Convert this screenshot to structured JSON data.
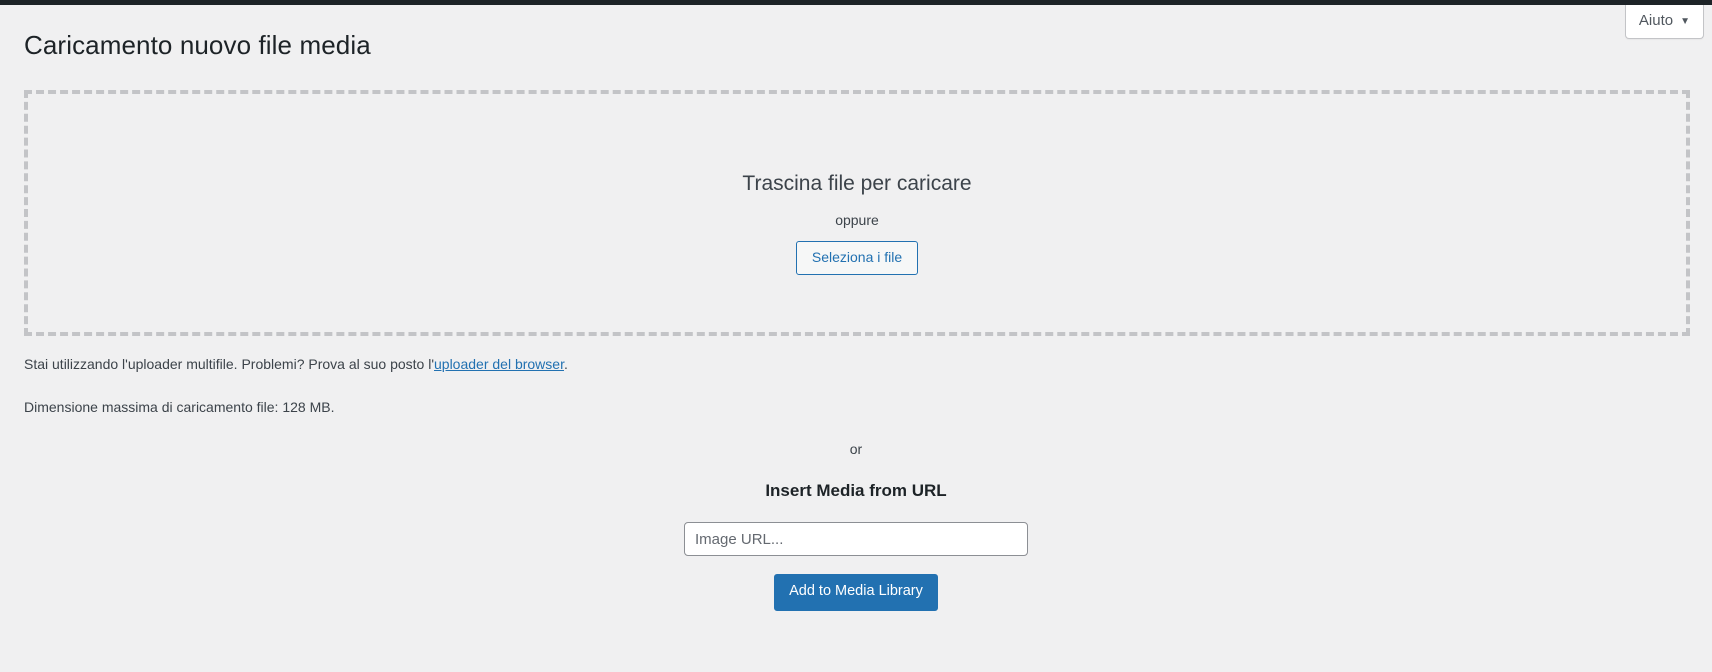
{
  "header": {
    "page_title": "Caricamento nuovo file media",
    "help_button_label": "Aiuto",
    "help_caret_icon": "chevron-down-icon"
  },
  "dropzone": {
    "instructions": "Trascina file per caricare",
    "or_label": "oppure",
    "select_files_label": "Seleziona i file"
  },
  "notes": {
    "multifile_prefix": "Stai utilizzando l'uploader multifile. Problemi? Prova al suo posto l'",
    "multifile_link": "uploader del browser",
    "multifile_suffix": ".",
    "max_upload_size": "Dimensione massima di caricamento file: 128 MB."
  },
  "url_section": {
    "or_label": "or",
    "heading": "Insert Media from URL",
    "input_placeholder": "Image URL...",
    "input_value": "",
    "submit_label": "Add to Media Library"
  },
  "colors": {
    "page_background": "#f0f0f1",
    "admin_bar": "#1d2327",
    "accent_blue": "#2271b1",
    "dashed_border": "#c3c4c7",
    "text": "#3c434a",
    "heading_text": "#1d2327"
  }
}
